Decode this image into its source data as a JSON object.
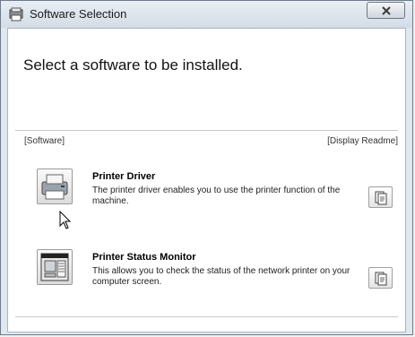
{
  "window": {
    "title": "Software Selection",
    "close_icon": "close-icon"
  },
  "content": {
    "heading": "Select a software to be installed.",
    "section_label": "[Software]",
    "readme_label": "[Display Readme]"
  },
  "items": [
    {
      "title": "Printer Driver",
      "description": "The printer driver enables you to use the printer function of the machine.",
      "icon": "printer-icon",
      "readme_icon": "readme-document-icon"
    },
    {
      "title": "Printer Status Monitor",
      "description": "This allows you to check the status of the network printer on your computer screen.",
      "icon": "status-monitor-icon",
      "readme_icon": "readme-document-icon"
    }
  ],
  "colors": {
    "title_bar": "#dfe7ef",
    "client_bg": "#ffffff",
    "border": "#6d7b8b"
  }
}
